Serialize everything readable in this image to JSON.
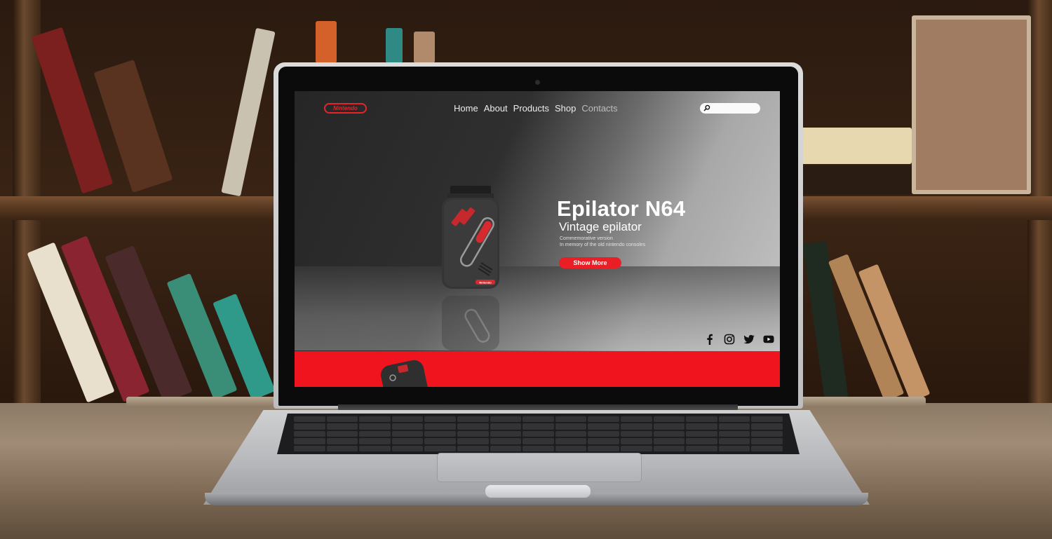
{
  "site": {
    "logo_text": "Nintendo",
    "nav": [
      {
        "label": "Home"
      },
      {
        "label": "About"
      },
      {
        "label": "Products"
      },
      {
        "label": "Shop"
      },
      {
        "label": "Contacts"
      }
    ],
    "search": {
      "placeholder": ""
    },
    "hero": {
      "title": "Epilator N64",
      "subtitle": "Vintage epilator",
      "desc_line1": "Commemorative version",
      "desc_line2": "In memory of the old nintendo consoles",
      "button_label": "Show More"
    },
    "product_badge": "Nintendo",
    "social": [
      "facebook-icon",
      "instagram-icon",
      "twitter-icon",
      "youtube-icon"
    ]
  },
  "colors": {
    "accent_red": "#ea1f26",
    "band_red": "#f0141e",
    "hero_text": "#ffffff"
  }
}
